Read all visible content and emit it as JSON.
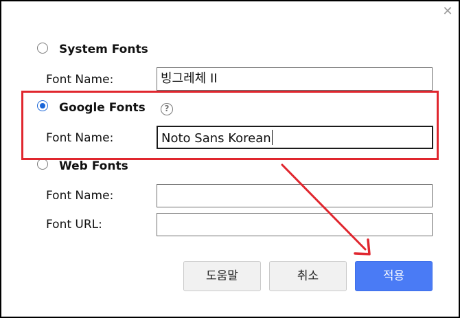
{
  "dialog": {
    "close_glyph": "✕"
  },
  "system_fonts": {
    "title": "System Fonts",
    "font_name_label": "Font Name:",
    "font_name_value": "빙그레체 II",
    "selected": false
  },
  "google_fonts": {
    "title": "Google Fonts",
    "help_glyph": "?",
    "font_name_label": "Font Name:",
    "font_name_value": "Noto Sans Korean",
    "selected": true
  },
  "web_fonts": {
    "title": "Web Fonts",
    "font_name_label": "Font Name:",
    "font_name_value": "",
    "font_url_label": "Font URL:",
    "font_url_value": "",
    "selected": false
  },
  "buttons": {
    "help_label": "도움말",
    "cancel_label": "취소",
    "apply_label": "적용"
  },
  "colors": {
    "highlight": "#e0262e",
    "primary_button": "#4a7bf5",
    "radio_selected": "#1a66d8"
  }
}
